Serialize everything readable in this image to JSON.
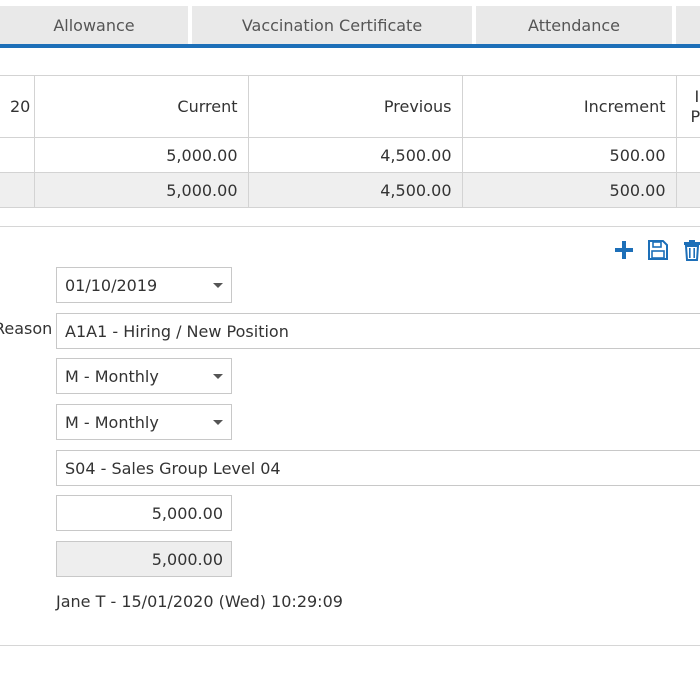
{
  "tabs": [
    {
      "label": "Allowance"
    },
    {
      "label": "Vaccination Certificate"
    },
    {
      "label": "Attendance"
    }
  ],
  "grid": {
    "headers": {
      "col0": "20",
      "current": "Current",
      "previous": "Previous",
      "increment": "Increment",
      "col_trunc_line1": "I",
      "col_trunc_line2": "Pe"
    },
    "rows": [
      {
        "current": "5,000.00",
        "previous": "4,500.00",
        "increment": "500.00"
      },
      {
        "current": "5,000.00",
        "previous": "4,500.00",
        "increment": "500.00"
      }
    ]
  },
  "toolbar": {
    "add_icon": "plus-icon",
    "save_icon": "floppy-disk-icon",
    "delete_icon": "trash-icon",
    "accent": "#1d6fb8"
  },
  "form": {
    "date": "01/10/2019",
    "reason_label": "Reason",
    "reason": "A1A1 - Hiring / New Position",
    "frequency1": "M - Monthly",
    "frequency2": "M - Monthly",
    "group": "S04 - Sales Group Level 04",
    "amount": "5,000.00",
    "amount_readonly": "5,000.00",
    "audit": "Jane T - 15/01/2020 (Wed) 10:29:09"
  }
}
